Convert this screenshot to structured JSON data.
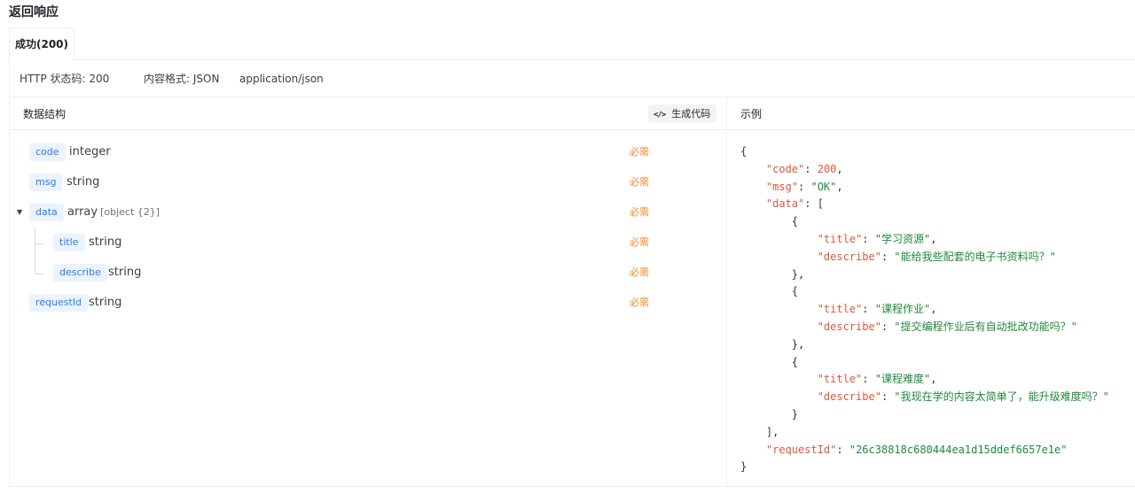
{
  "section_title": "返回响应",
  "tabs": [
    {
      "label": "成功(200)"
    }
  ],
  "meta": {
    "status": "HTTP 状态码: 200",
    "format": "内容格式: JSON",
    "mime": "application/json"
  },
  "left_pane": {
    "title": "数据结构",
    "gen_button": "生成代码",
    "gen_button_icon": "code-icon",
    "fields": [
      {
        "name": "code",
        "type": "integer",
        "sub": "",
        "required": "必需"
      },
      {
        "name": "msg",
        "type": "string",
        "sub": "",
        "required": "必需"
      },
      {
        "name": "data",
        "type": "array",
        "sub": "[object {2}]",
        "required": "必需",
        "toggle": "▼"
      },
      {
        "name": "title",
        "type": "string",
        "sub": "",
        "required": "必需"
      },
      {
        "name": "describe",
        "type": "string",
        "sub": "",
        "required": "必需"
      },
      {
        "name": "requestId",
        "type": "string",
        "sub": "",
        "required": "必需"
      }
    ]
  },
  "right_pane": {
    "title": "示例",
    "code_lines": [
      "{",
      "    \"code\": 200,",
      "    \"msg\": \"OK\",",
      "    \"data\": [",
      "        {",
      "            \"title\": \"学习资源\",",
      "            \"describe\": \"能给我些配套的电子书资料吗？\"",
      "        },",
      "        {",
      "            \"title\": \"课程作业\",",
      "            \"describe\": \"提交编程作业后有自动批改功能吗？\"",
      "        },",
      "        {",
      "            \"title\": \"课程难度\",",
      "            \"describe\": \"我现在学的内容太简单了，能升级难度吗？\"",
      "        }",
      "    ],",
      "    \"requestId\": \"26c38818c680444ea1d15ddef6657e1e\"",
      "}"
    ]
  },
  "colors": {
    "tag_bg": "#eaf3fe",
    "tag_text": "#2f7bec",
    "required": "#f08a24",
    "json_key": "#e0573e",
    "json_string": "#1e8a3a"
  }
}
